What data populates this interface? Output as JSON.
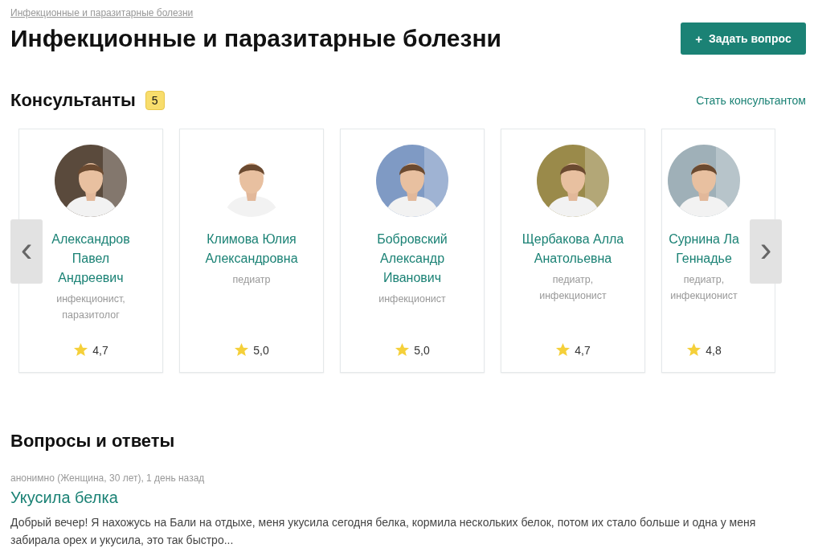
{
  "breadcrumb": "Инфекционные и паразитарные болезни",
  "title": "Инфекционные и паразитарные болезни",
  "ask_button": {
    "icon": "+",
    "label": "Задать вопрос"
  },
  "consultants": {
    "heading": "Консультанты",
    "count": "5",
    "link": "Стать консультантом",
    "prev": "‹",
    "next": "›",
    "items": [
      {
        "name": "Александров\nПавел\nАндреевич",
        "specialty": "инфекционист,\nпаразитолог",
        "rating": "4,7"
      },
      {
        "name": "Климова Юлия\nАлександровна",
        "specialty": "педиатр",
        "rating": "5,0"
      },
      {
        "name": "Бобровский\nАлександр\nИванович",
        "specialty": "инфекционист",
        "rating": "5,0"
      },
      {
        "name": "Щербакова Алла\nАнатольевна",
        "specialty": "педиатр,\nинфекционист",
        "rating": "4,7"
      },
      {
        "name": "Сурнина Ла\nГеннадье",
        "specialty": "педиатр,\nинфекционист",
        "rating": "4,8"
      }
    ]
  },
  "qa": {
    "heading": "Вопросы и ответы",
    "items": [
      {
        "meta": "анонимно (Женщина, 30 лет), 1 день назад",
        "title": "Укусила белка",
        "text": "Добрый вечер! Я нахожусь на Бали на отдыхе, меня укусила сегодня белка, кормила нескольких белок, потом их стало больше и одна у меня забирала орех и укусила, это так быстро..."
      }
    ]
  }
}
